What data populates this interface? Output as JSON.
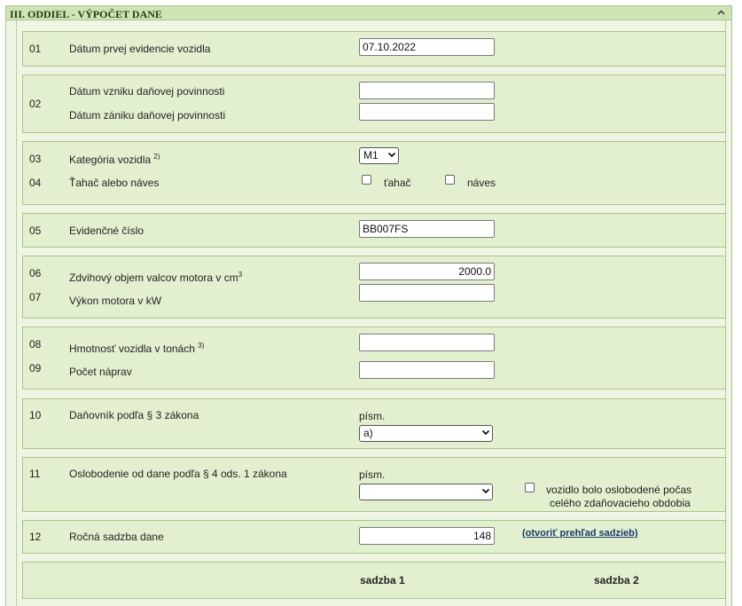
{
  "header": {
    "title": "III. ODDIEL - VÝPOČET DANE"
  },
  "rows": {
    "r01": {
      "num": "01",
      "label": "Dátum prvej evidencie vozidla",
      "value": "07.10.2022"
    },
    "r02": {
      "num": "02",
      "label_a": "Dátum vzniku daňovej povinnosti",
      "label_b": "Dátum zániku daňovej povinnosti",
      "value_a": "",
      "value_b": ""
    },
    "r03": {
      "num": "03",
      "label": "Kategória vozidla",
      "sup": "2)",
      "selected": "M1"
    },
    "r04": {
      "num": "04",
      "label": "Ťahač alebo náves",
      "opt_a": "ťahač",
      "opt_b": "náves"
    },
    "r05": {
      "num": "05",
      "label": "Evidenčné číslo",
      "value": "BB007FS"
    },
    "r06": {
      "num": "06",
      "label": "Zdvihový objem valcov motora v cm",
      "sup": "3",
      "value": "2000.0"
    },
    "r07": {
      "num": "07",
      "label": "Výkon motora v kW",
      "value": ""
    },
    "r08": {
      "num": "08",
      "label": "Hmotnosť vozidla v tonách",
      "sup": "3)",
      "value": ""
    },
    "r09": {
      "num": "09",
      "label": "Počet náprav",
      "value": ""
    },
    "r10": {
      "num": "10",
      "label": "Daňovník podľa § 3 zákona",
      "pism": "písm.",
      "selected": "a)"
    },
    "r11": {
      "num": "11",
      "label": "Oslobodenie od dane podľa § 4 ods. 1 zákona",
      "pism": "písm.",
      "selected": "",
      "check_line1": "vozidlo bolo oslobodené počas",
      "check_line2": "celého zdaňovacieho obdobia"
    },
    "r12": {
      "num": "12",
      "label": "Ročná sadzba dane",
      "value": "148",
      "link": "(otvoriť prehľad sadzieb)"
    },
    "rates": {
      "col1": "sadzba 1",
      "col2": "sadzba 2"
    }
  }
}
